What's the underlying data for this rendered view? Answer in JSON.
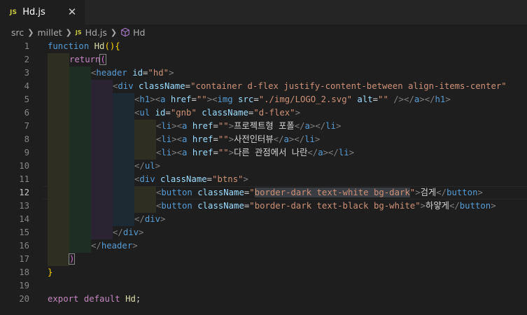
{
  "tab": {
    "badge": "JS",
    "title": "Hd.js",
    "close_glyph": "✕"
  },
  "breadcrumb": {
    "items": [
      "src",
      "millet",
      "Hd.js",
      "Hd"
    ],
    "js_badge": "JS",
    "chevron": "❯",
    "symbol_icon": "cube-icon"
  },
  "line_numbers": [
    "1",
    "2",
    "3",
    "4",
    "5",
    "6",
    "7",
    "8",
    "9",
    "10",
    "11",
    "12",
    "13",
    "14",
    "15",
    "16",
    "17",
    "18",
    "19",
    "20"
  ],
  "current_line": "12",
  "code": {
    "l1": {
      "kw": "function",
      "name": "Hd",
      "paren": "()",
      "brace": "{"
    },
    "l2": {
      "kw": "return",
      "paren": "("
    },
    "l3": {
      "tag": "header",
      "attr": "id",
      "val": "\"hd\""
    },
    "l4": {
      "tag": "div",
      "attr": "className",
      "val": "\"container d-flex justify-content-between align-items-center\""
    },
    "l5": {
      "h1": "h1",
      "a": "a",
      "href": "href",
      "href_val": "\"\"",
      "img": "img",
      "src": "src",
      "src_val": "\"./img/LOGO_2.svg\"",
      "alt": "alt",
      "alt_val": "\"\"",
      "self_close": " /"
    },
    "l6": {
      "tag": "ul",
      "attr_id": "id",
      "id_val": "\"gnb\"",
      "attr_class": "className",
      "class_val": "\"d-flex\""
    },
    "l7": {
      "li": "li",
      "a": "a",
      "href": "href",
      "href_val": "\"\"",
      "text": "프로젝트형 포폴"
    },
    "l8": {
      "li": "li",
      "a": "a",
      "href": "href",
      "href_val": "\"\"",
      "text": "사전인터뷰"
    },
    "l9": {
      "li": "li",
      "a": "a",
      "href": "href",
      "href_val": "\"\"",
      "text": "다른 관점에서 나란"
    },
    "l10": {
      "tag": "ul"
    },
    "l11": {
      "tag": "div",
      "attr": "className",
      "val": "\"btns\""
    },
    "l12": {
      "tag": "button",
      "attr": "className",
      "q": "\"",
      "val": "border-dark text-white bg-dark",
      "text": "검게"
    },
    "l13": {
      "tag": "button",
      "attr": "className",
      "q": "\"",
      "val": "border-dark text-black bg-white",
      "text": "하얗게"
    },
    "l14": {
      "tag": "div"
    },
    "l15": {
      "tag": "div"
    },
    "l16": {
      "tag": "header"
    },
    "l17": {
      "paren": ")"
    },
    "l18": {
      "brace": "}"
    },
    "l20": {
      "kw1": "export",
      "kw2": "default",
      "name": "Hd",
      "semi": ";"
    }
  },
  "colors": {
    "background": "#1e1e1e",
    "keyword": "#569cd6",
    "control": "#c586c0",
    "function": "#dcdcaa",
    "attribute": "#9cdcfe",
    "string": "#ce9178"
  }
}
